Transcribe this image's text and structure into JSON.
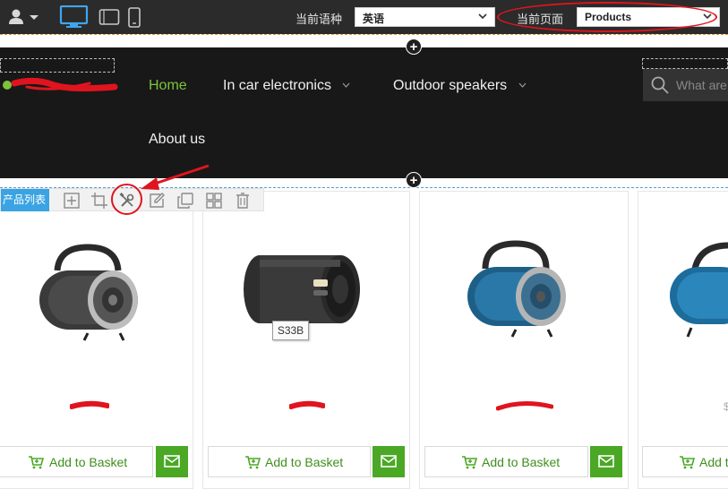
{
  "editor": {
    "language_label": "当前语种",
    "language_value": "英语",
    "page_label": "当前页面",
    "page_value": "Products"
  },
  "site": {
    "nav": {
      "home": "Home",
      "in_car": "In car electronics",
      "outdoor": "Outdoor speakers",
      "about": "About us"
    },
    "search_placeholder": "What are"
  },
  "module": {
    "tag": "产品列表"
  },
  "products": {
    "tooltip": "S33B",
    "basket_label": "Add to Basket",
    "basket_label_partial": "Add to",
    "price_fragment_4": "$"
  },
  "colors": {
    "accent_green": "#7cc33b",
    "basket_green": "#4aa825",
    "annotation_red": "#e0141e",
    "module_blue": "#3aa3e3"
  }
}
